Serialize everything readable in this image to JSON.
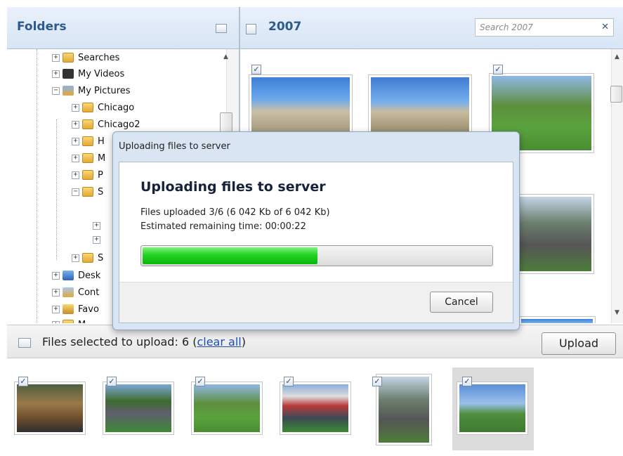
{
  "folders_panel": {
    "title": "Folders"
  },
  "gallery_panel": {
    "title": "2007",
    "search_placeholder": "Search 2007"
  },
  "tree": {
    "items": [
      {
        "label": "Searches"
      },
      {
        "label": "My Videos"
      },
      {
        "label": "My Pictures"
      },
      {
        "label": "Chicago"
      },
      {
        "label": "Chicago2"
      },
      {
        "label": "H"
      },
      {
        "label": "M"
      },
      {
        "label": "P"
      },
      {
        "label": "S"
      },
      {
        "label": "S"
      },
      {
        "label": "Desk"
      },
      {
        "label": "Cont"
      },
      {
        "label": "Favo"
      },
      {
        "label": "M"
      }
    ]
  },
  "dialog": {
    "title": "Uploading files to server",
    "heading": "Uploading files to server",
    "files_line": "Files uploaded 3/6 (6 042 Kb of 6 042 Kb)",
    "time_line": "Estimated remaining time: 00:00:22",
    "progress": 0.5,
    "cancel_label": "Cancel"
  },
  "bottom_bar": {
    "text": "Files selected to upload: 6 (",
    "link": "clear all",
    "text_end": ")",
    "upload_label": "Upload"
  }
}
